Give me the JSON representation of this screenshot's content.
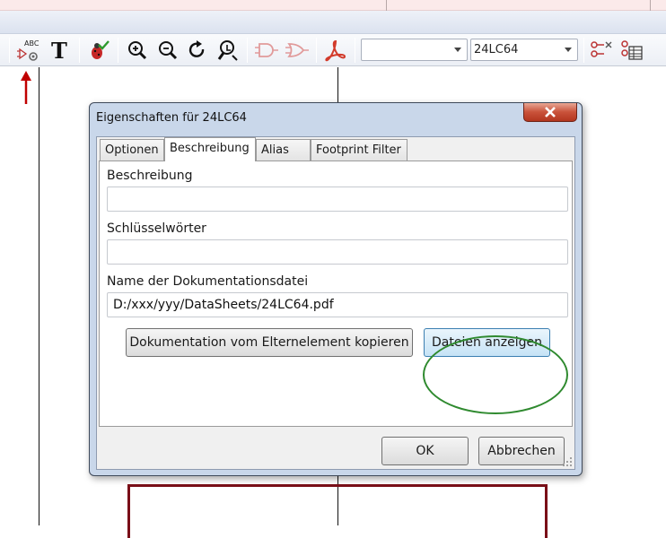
{
  "toolbar": {
    "icons": [
      "add-field-text-icon",
      "text-icon",
      "check-bug-icon",
      "zoom-in-icon",
      "zoom-out-icon",
      "redraw-icon",
      "zoom-fit-icon",
      "gate-a-icon",
      "gate-b-icon",
      "pdf-icon",
      "pin-table-icon",
      "pin-list-icon"
    ],
    "unit_combo_value": "",
    "part_combo_value": "24LC64"
  },
  "dialog": {
    "title": "Eigenschaften für 24LC64",
    "tabs": [
      {
        "label": "Optionen",
        "active": false
      },
      {
        "label": "Beschreibung",
        "active": true
      },
      {
        "label": "Alias",
        "active": false
      },
      {
        "label": "Footprint Filter",
        "active": false
      }
    ],
    "description_label": "Beschreibung",
    "description_value": "",
    "keywords_label": "Schlüsselwörter",
    "keywords_value": "",
    "docfile_label": "Name der Dokumentationsdatei",
    "docfile_value": "D:/xxx/yyy/DataSheets/24LC64.pdf",
    "copy_doc_button": "Dokumentation vom Elternelement kopieren",
    "browse_button": "Dateien anzeigen",
    "ok_button": "OK",
    "cancel_button": "Abbrechen"
  },
  "annotations": {
    "arrow_color": "#c00000",
    "highlight_color": "#2f8a2f"
  }
}
